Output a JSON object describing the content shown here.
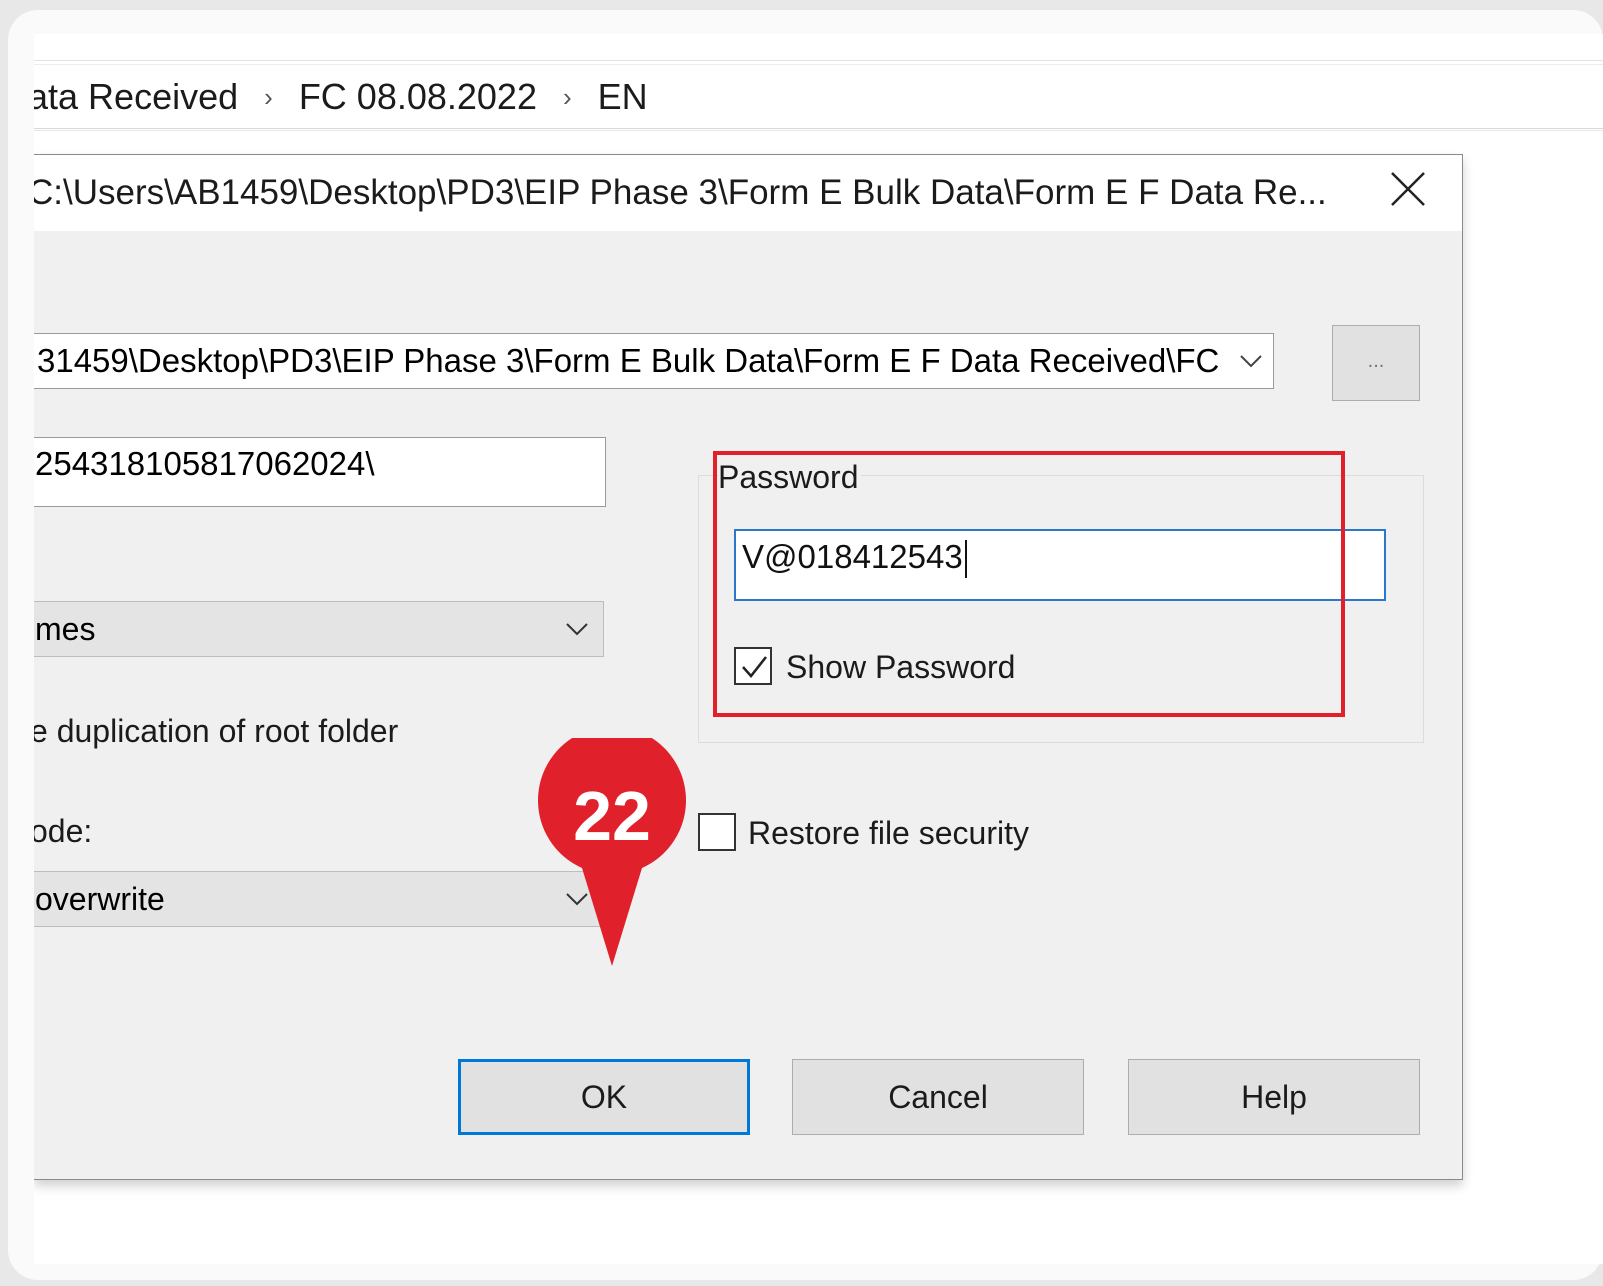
{
  "breadcrumb": {
    "seg1": "ata Received",
    "seg2": "FC 08.08.2022",
    "seg3": "EN"
  },
  "dialog": {
    "title": "C:\\Users\\AB1459\\Desktop\\PD3\\EIP Phase 3\\Form E Bulk Data\\Form E F Data Re...",
    "path_value": "31459\\Desktop\\PD3\\EIP Phase 3\\Form E Bulk Data\\Form E F Data Received\\FC",
    "browse_label": "...",
    "id_field_value": "254318105817062024\\",
    "combo_a_value": "mes",
    "dup_label": "e duplication of root folder",
    "mode_label": "ode:",
    "combo_b_value": "overwrite",
    "password": {
      "label": "Password",
      "value": "V@018412543",
      "show_label": "Show Password",
      "show_checked": true
    },
    "restore_label": "Restore file security",
    "restore_checked": false,
    "buttons": {
      "ok": "OK",
      "cancel": "Cancel",
      "help": "Help"
    }
  },
  "annotation": {
    "step_number": "22",
    "color": "#e0202a"
  },
  "icons": {
    "close": "close-icon",
    "dropdown": "chevron-down-icon",
    "breadcrumb_sep": "chevron-right-icon",
    "check": "checkmark-icon"
  }
}
